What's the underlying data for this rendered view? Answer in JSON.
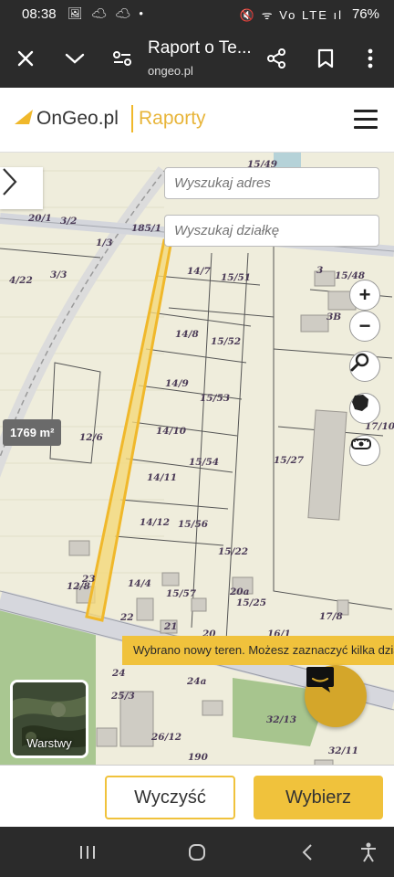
{
  "status_bar": {
    "time": "08:38",
    "left_icons": "🖼 ☁ ☁ •",
    "right_icons": "🔇 ᯤ Vo LTE ıl",
    "battery": "76%"
  },
  "browser": {
    "title": "Raport o Te...",
    "url": "ongeo.pl"
  },
  "header": {
    "logo_name": "OnGeo.pl",
    "logo_section": "Raporty",
    "brand_color": "#f0c23c"
  },
  "map": {
    "search_address_placeholder": "Wyszukaj adres",
    "search_parcel_placeholder": "Wyszukaj działkę",
    "zoom_in": "+",
    "zoom_out": "−",
    "area_badge": "1769 m²",
    "toast": "Wybrano nowy teren. Możesz zaznaczyć kilka działek",
    "layers_label": "Warstwy",
    "parcel_labels": [
      "15/49",
      "20/1",
      "3/2",
      "185/1",
      "1/3",
      "4/22",
      "3/3",
      "14/7",
      "15/51",
      "3",
      "15/48",
      "3B",
      "14/8",
      "15/52",
      "14/9",
      "15/53",
      "14/10",
      "12/6",
      "15/54",
      "15/27",
      "14/11",
      "14/12",
      "15/56",
      "15/22",
      "12/8",
      "23",
      "14/4",
      "15/57",
      "20a",
      "15/25",
      "22",
      "21",
      "17/8",
      "20",
      "16/1",
      "24",
      "24a",
      "25/3",
      "32/13",
      "26/12",
      "190",
      "32/11",
      "17/10"
    ]
  },
  "footer": {
    "clear_label": "Wyczyść",
    "select_label": "Wybierz"
  },
  "icons": {
    "close": "close-icon",
    "collapse": "chevron-down-icon",
    "page_settings": "tune-icon",
    "share": "share-icon",
    "bookmark": "bookmark-icon",
    "more": "more-vert-icon"
  }
}
